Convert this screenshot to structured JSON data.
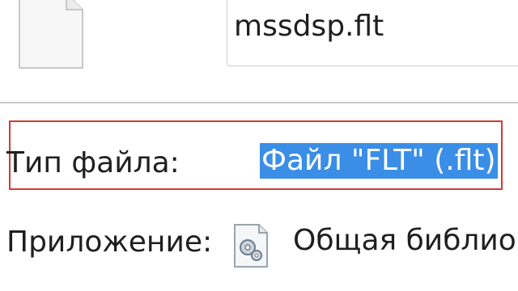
{
  "file": {
    "name": "mssdsp.flt",
    "icon": "blank-file-icon"
  },
  "type_row": {
    "label": "Тип файла:",
    "value": "Файл \"FLT\" (.flt)"
  },
  "app_row": {
    "label": "Приложение:",
    "value": "Общая библио",
    "icon": "shared-library-gear-icon"
  },
  "colors": {
    "selection": "#3a8ee6",
    "highlight_border": "#d23a33"
  }
}
